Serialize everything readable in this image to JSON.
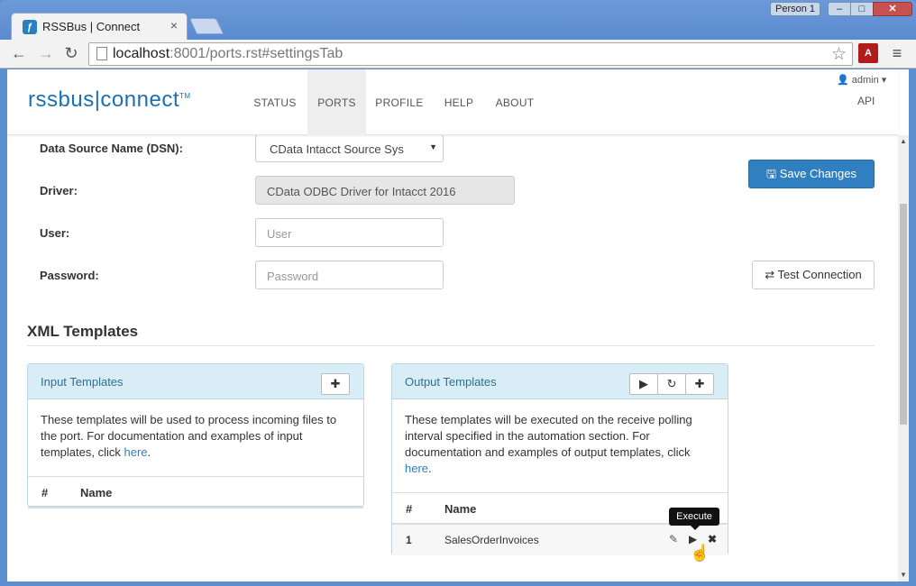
{
  "browser": {
    "tab_title": "RSSBus | Connect",
    "favicon": "ƒ",
    "person": "Person 1",
    "url_host": "localhost",
    "url_rest": ":8001/ports.rst#settingsTab",
    "pdf_label": "A"
  },
  "app": {
    "logo_left": "rssbus",
    "logo_sep": "|",
    "logo_right": "connect",
    "logo_tm": "TM",
    "nav": [
      "STATUS",
      "PORTS",
      "PROFILE",
      "HELP",
      "ABOUT"
    ],
    "active_nav": "PORTS",
    "admin": "admin",
    "api": "API"
  },
  "form": {
    "dsn_label": "Data Source Name (DSN):",
    "dsn_value": "CData Intacct Source Sys",
    "driver_label": "Driver:",
    "driver_value": "CData ODBC Driver for Intacct 2016",
    "user_label": "User:",
    "user_placeholder": "User",
    "password_label": "Password:",
    "password_placeholder": "Password",
    "save_button": "Save Changes",
    "test_button": "Test Connection"
  },
  "xml_templates": {
    "title": "XML Templates",
    "input": {
      "title": "Input Templates",
      "desc": "These templates will be used to process incoming files to the port. For documentation and examples of input templates, click ",
      "link": "here",
      "col_num": "#",
      "col_name": "Name"
    },
    "output": {
      "title": "Output Templates",
      "desc": "These templates will be executed on the receive polling interval specified in the automation section. For documentation and examples of output templates, click ",
      "link": "here",
      "col_num": "#",
      "col_name": "Name",
      "rows": [
        {
          "num": "1",
          "name": "SalesOrderInvoices"
        }
      ]
    }
  },
  "tooltip": "Execute",
  "colors": {
    "primary": "#2f7fc1",
    "panel_head": "#d9edf7",
    "panel_title": "#31708f"
  }
}
